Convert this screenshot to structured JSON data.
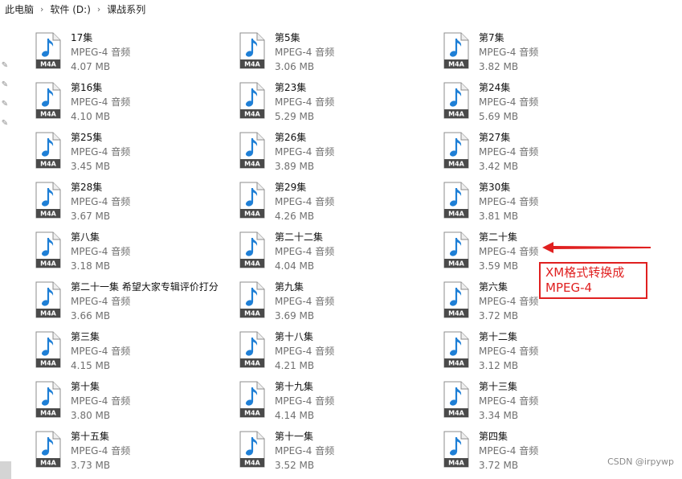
{
  "breadcrumb": [
    "此电脑",
    "软件 (D:)",
    "课战系列"
  ],
  "files": [
    {
      "name": "17集",
      "type": "MPEG-4 音频",
      "size": "4.07 MB",
      "icon": "m4a-file-icon"
    },
    {
      "name": "第5集",
      "type": "MPEG-4 音频",
      "size": "3.06 MB",
      "icon": "m4a-file-icon"
    },
    {
      "name": "第7集",
      "type": "MPEG-4 音频",
      "size": "3.82 MB",
      "icon": "m4a-file-icon"
    },
    {
      "name": "第16集",
      "type": "MPEG-4 音频",
      "size": "4.10 MB",
      "icon": "m4a-file-icon"
    },
    {
      "name": "第23集",
      "type": "MPEG-4 音频",
      "size": "5.29 MB",
      "icon": "m4a-file-icon"
    },
    {
      "name": "第24集",
      "type": "MPEG-4 音频",
      "size": "5.69 MB",
      "icon": "m4a-file-icon"
    },
    {
      "name": "第25集",
      "type": "MPEG-4 音频",
      "size": "3.45 MB",
      "icon": "m4a-file-icon"
    },
    {
      "name": "第26集",
      "type": "MPEG-4 音频",
      "size": "3.89 MB",
      "icon": "m4a-file-icon"
    },
    {
      "name": "第27集",
      "type": "MPEG-4 音频",
      "size": "3.42 MB",
      "icon": "m4a-file-icon"
    },
    {
      "name": "第28集",
      "type": "MPEG-4 音频",
      "size": "3.67 MB",
      "icon": "m4a-file-icon"
    },
    {
      "name": "第29集",
      "type": "MPEG-4 音频",
      "size": "4.26 MB",
      "icon": "m4a-file-icon"
    },
    {
      "name": "第30集",
      "type": "MPEG-4 音频",
      "size": "3.81 MB",
      "icon": "m4a-file-icon"
    },
    {
      "name": "第八集",
      "type": "MPEG-4 音频",
      "size": "3.18 MB",
      "icon": "m4a-file-icon"
    },
    {
      "name": "第二十二集",
      "type": "MPEG-4 音频",
      "size": "4.04 MB",
      "icon": "m4a-file-icon"
    },
    {
      "name": "第二十集",
      "type": "MPEG-4 音频",
      "size": "3.59 MB",
      "icon": "m4a-file-icon"
    },
    {
      "name": "第二十一集 希望大家专辑评价打分",
      "type": "MPEG-4 音频",
      "size": "3.66 MB",
      "icon": "m4a-file-icon"
    },
    {
      "name": "第九集",
      "type": "MPEG-4 音频",
      "size": "3.69 MB",
      "icon": "m4a-file-icon"
    },
    {
      "name": "第六集",
      "type": "MPEG-4 音频",
      "size": "3.72 MB",
      "icon": "m4a-file-icon"
    },
    {
      "name": "第三集",
      "type": "MPEG-4 音频",
      "size": "4.15 MB",
      "icon": "m4a-file-icon"
    },
    {
      "name": "第十八集",
      "type": "MPEG-4 音频",
      "size": "4.21 MB",
      "icon": "m4a-file-icon"
    },
    {
      "name": "第十二集",
      "type": "MPEG-4 音频",
      "size": "3.12 MB",
      "icon": "m4a-file-icon"
    },
    {
      "name": "第十集",
      "type": "MPEG-4 音频",
      "size": "3.80 MB",
      "icon": "m4a-file-icon"
    },
    {
      "name": "第十九集",
      "type": "MPEG-4 音频",
      "size": "4.14 MB",
      "icon": "m4a-file-icon"
    },
    {
      "name": "第十三集",
      "type": "MPEG-4 音频",
      "size": "3.34 MB",
      "icon": "m4a-file-icon"
    },
    {
      "name": "第十五集",
      "type": "MPEG-4 音频",
      "size": "3.73 MB",
      "icon": "m4a-file-icon"
    },
    {
      "name": "第十一集",
      "type": "MPEG-4 音频",
      "size": "3.52 MB",
      "icon": "m4a-file-icon"
    },
    {
      "name": "第四集",
      "type": "MPEG-4 音频",
      "size": "3.72 MB",
      "icon": "m4a-file-icon"
    }
  ],
  "icon_label": "M4A",
  "annotation": {
    "line1": "XM格式转换成",
    "line2": "MPEG-4",
    "color": "#e02020"
  },
  "watermark": "CSDN @irpywp",
  "colors": {
    "accent": "#1e7fd6",
    "annotation": "#e02020"
  }
}
